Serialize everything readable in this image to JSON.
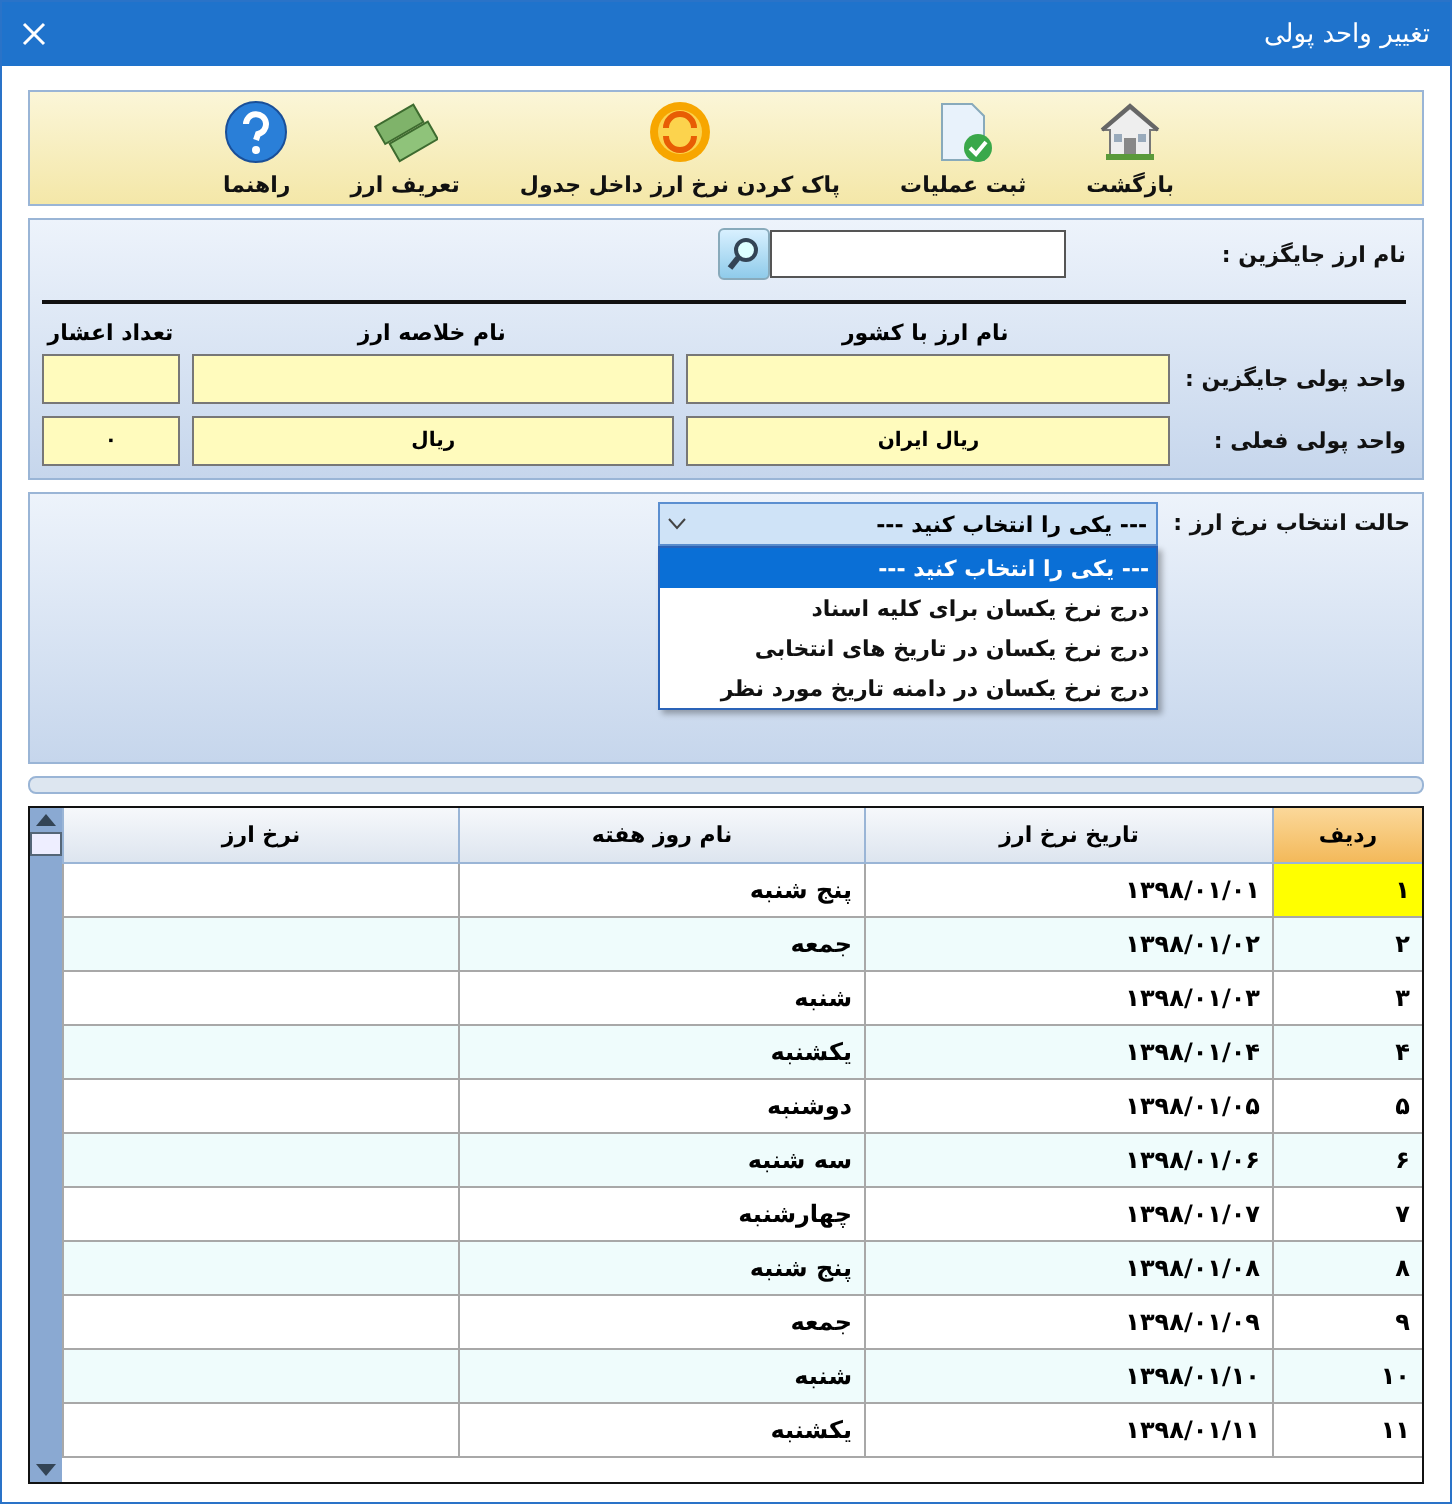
{
  "window": {
    "title": "تغییر واحد پولی"
  },
  "toolbar": [
    {
      "kind": "home",
      "label": "بازگشت"
    },
    {
      "kind": "document",
      "label": "ثبت عملیات"
    },
    {
      "kind": "refresh",
      "label": "پاک کردن نرخ ارز داخل جدول"
    },
    {
      "kind": "money",
      "label": "تعریف ارز"
    },
    {
      "kind": "help",
      "label": "راهنما"
    }
  ],
  "search": {
    "label": "نام ارز جایگزین :"
  },
  "currency": {
    "columns": [
      "نام ارز با کشور",
      "نام خلاصه ارز",
      "تعداد اعشار"
    ],
    "rows": [
      {
        "label": "واحد پولی جایگزین :",
        "fields": [
          {
            "kind": "text"
          },
          {
            "kind": "text"
          },
          {
            "kind": "text"
          }
        ]
      },
      {
        "label": "واحد پولی فعلی :",
        "fields": [
          {
            "kind": "text",
            "value": "ریال ایران"
          },
          {
            "kind": "text",
            "value": "ریال"
          },
          {
            "kind": "text",
            "value": "۰"
          }
        ]
      }
    ]
  },
  "rate_mode": {
    "label": "حالت انتخاب نرخ ارز :",
    "value": "--- یکی را انتخاب کنید ---",
    "expanded": true,
    "options": [
      {
        "label": "--- یکی را انتخاب کنید ---",
        "selected": true
      },
      {
        "label": "درج نرخ یکسان برای کلیه اسناد",
        "selected": false
      },
      {
        "label": "درج نرخ یکسان در تاریخ های انتخابی",
        "selected": false
      },
      {
        "label": "درج نرخ یکسان در دامنه تاریخ مورد نظر",
        "selected": false
      }
    ]
  },
  "table": {
    "columns": [
      "ردیف",
      "تاریخ نرخ ارز",
      "نام روز هفته",
      "نرخ ارز"
    ],
    "rows": [
      {
        "cells": [
          "۱",
          "۱۳۹۸/۰۱/۰۱",
          "پنج شنبه",
          ""
        ],
        "selected": true
      },
      {
        "cells": [
          "۲",
          "۱۳۹۸/۰۱/۰۲",
          "جمعه",
          ""
        ],
        "selected": false
      },
      {
        "cells": [
          "۳",
          "۱۳۹۸/۰۱/۰۳",
          "شنبه",
          ""
        ],
        "selected": false
      },
      {
        "cells": [
          "۴",
          "۱۳۹۸/۰۱/۰۴",
          "یکشنبه",
          ""
        ],
        "selected": false
      },
      {
        "cells": [
          "۵",
          "۱۳۹۸/۰۱/۰۵",
          "دوشنبه",
          ""
        ],
        "selected": false
      },
      {
        "cells": [
          "۶",
          "۱۳۹۸/۰۱/۰۶",
          "سه شنبه",
          ""
        ],
        "selected": false
      },
      {
        "cells": [
          "۷",
          "۱۳۹۸/۰۱/۰۷",
          "چهارشنبه",
          ""
        ],
        "selected": false
      },
      {
        "cells": [
          "۸",
          "۱۳۹۸/۰۱/۰۸",
          "پنج شنبه",
          ""
        ],
        "selected": false
      },
      {
        "cells": [
          "۹",
          "۱۳۹۸/۰۱/۰۹",
          "جمعه",
          ""
        ],
        "selected": false
      },
      {
        "cells": [
          "۱۰",
          "۱۳۹۸/۰۱/۱۰",
          "شنبه",
          ""
        ],
        "selected": false
      },
      {
        "cells": [
          "۱۱",
          "۱۳۹۸/۰۱/۱۱",
          "یکشنبه",
          ""
        ],
        "selected": false
      }
    ]
  }
}
